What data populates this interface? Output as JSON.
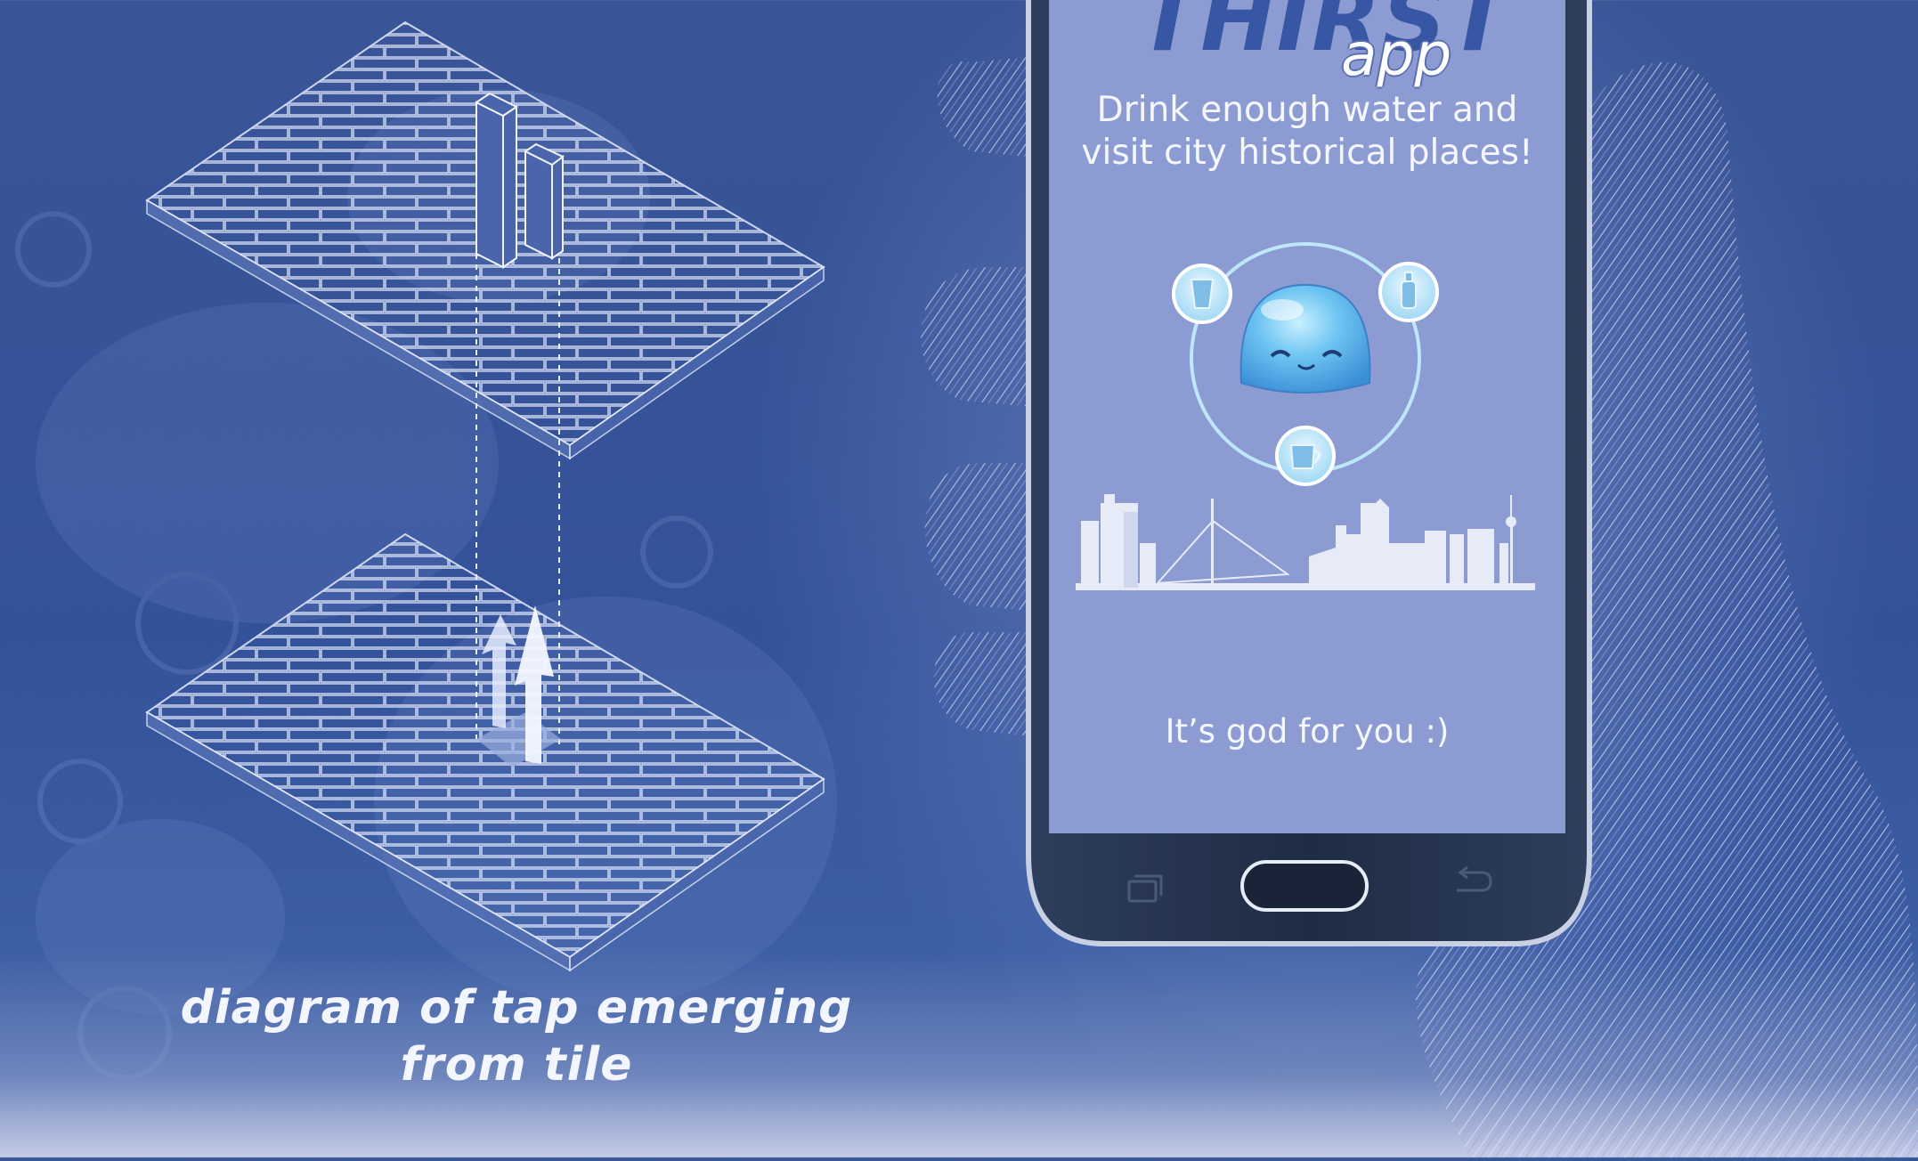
{
  "app": {
    "title": "THIRST",
    "subtitle": "app",
    "tagline_line1": "Drink enough water and",
    "tagline_line2": "visit city historical places!",
    "footer_message": "It’s god for you :)"
  },
  "diagram": {
    "caption_line1": "diagram of tap emerging",
    "caption_line2": "from tile"
  },
  "colors": {
    "background": "#3a5597",
    "screen": "#8c9bd2",
    "title_blue": "#3756a4",
    "mascot": "#5fb3ea",
    "hand_texture": "#c8c2ea"
  },
  "icons": [
    "glass-icon",
    "bottle-icon",
    "cup-icon",
    "recent-apps-icon",
    "back-icon"
  ]
}
